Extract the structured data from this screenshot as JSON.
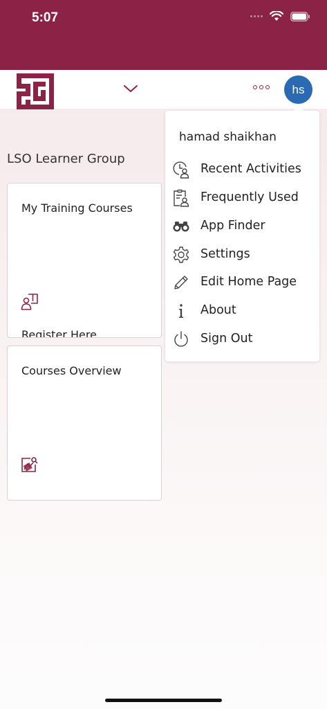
{
  "status_bar": {
    "time": "5:07"
  },
  "header": {
    "avatar_initials": "hs",
    "accent_color": "#8b2347",
    "avatar_color": "#2a6ab3"
  },
  "main": {
    "group_title": "LSO Learner Group",
    "cards": [
      {
        "title": "My Training Courses",
        "subtitle": "Register Here",
        "icon": "register-book-icon"
      },
      {
        "title": "Courses Overview",
        "subtitle": "",
        "icon": "courses-search-icon"
      }
    ]
  },
  "user_menu": {
    "user_name": "hamad shaikhan",
    "items": [
      {
        "label": "Recent Activities",
        "icon": "recent-activities-icon"
      },
      {
        "label": "Frequently Used",
        "icon": "frequently-used-icon"
      },
      {
        "label": "App Finder",
        "icon": "binoculars-icon"
      },
      {
        "label": "Settings",
        "icon": "gear-icon"
      },
      {
        "label": "Edit Home Page",
        "icon": "pencil-icon"
      },
      {
        "label": "About",
        "icon": "info-icon"
      },
      {
        "label": "Sign Out",
        "icon": "power-icon"
      }
    ]
  }
}
